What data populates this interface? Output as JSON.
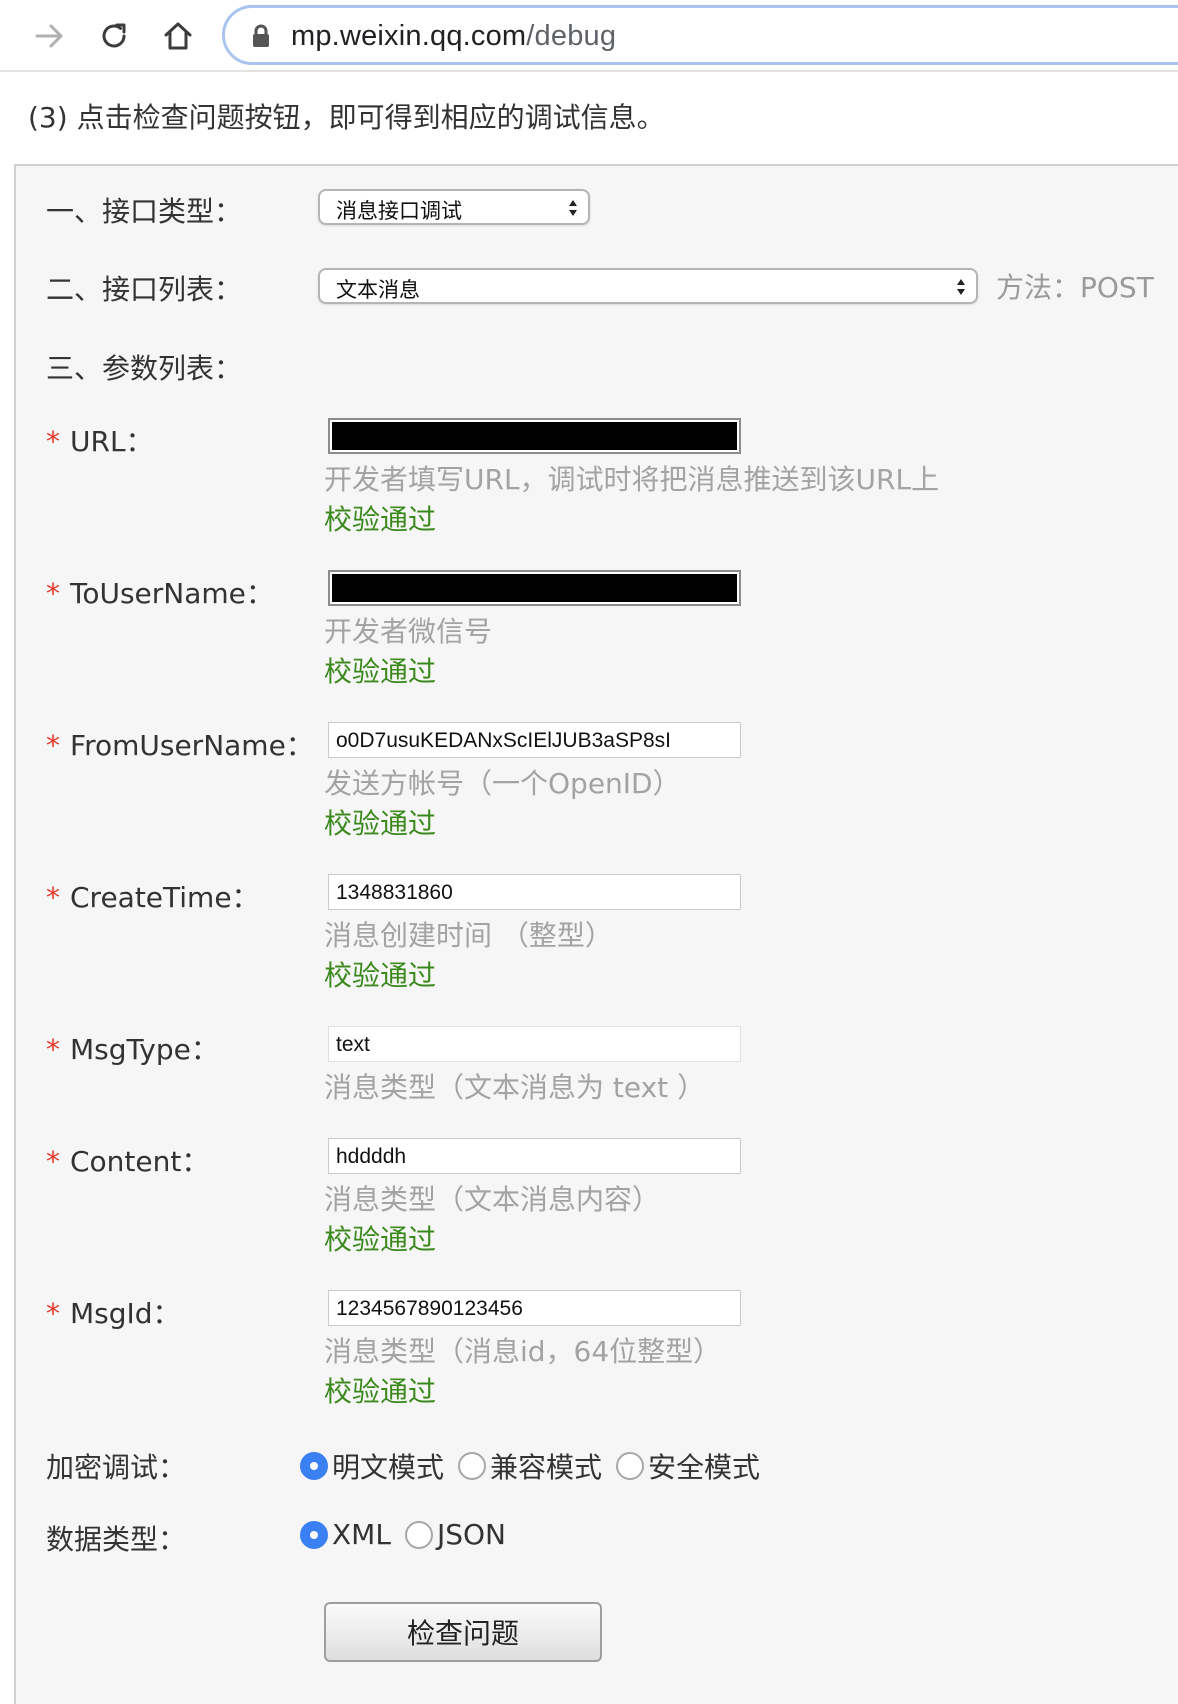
{
  "browser": {
    "url_host": "mp.weixin.qq.com",
    "url_path": "/debug"
  },
  "intro": "(3) 点击检查问题按钮，即可得到相应的调试信息。",
  "section1": {
    "label": "一、接口类型：",
    "select_value": "消息接口调试"
  },
  "section2": {
    "label": "二、接口列表：",
    "select_value": "文本消息",
    "method": "方法：POST"
  },
  "section3": {
    "label": "三、参数列表："
  },
  "required_mark": "*",
  "fields": [
    {
      "label": "URL：",
      "value": "",
      "hint": "开发者填写URL，调试时将把消息推送到该URL上",
      "status": "校验通过"
    },
    {
      "label": "ToUserName：",
      "value": "",
      "hint": "开发者微信号",
      "status": "校验通过"
    },
    {
      "label": "FromUserName：",
      "value": "o0D7usuKEDANxScIElJUB3aSP8sI",
      "hint": "发送方帐号（一个OpenID）",
      "status": "校验通过"
    },
    {
      "label": "CreateTime：",
      "value": "1348831860",
      "hint": "消息创建时间 （整型）",
      "status": "校验通过"
    },
    {
      "label": "MsgType：",
      "value": "text",
      "hint": "消息类型（文本消息为 text ）",
      "status": ""
    },
    {
      "label": "Content：",
      "value": "hddddh",
      "hint": "消息类型（文本消息内容）",
      "status": "校验通过"
    },
    {
      "label": "MsgId：",
      "value": "1234567890123456",
      "hint": "消息类型（消息id，64位整型）",
      "status": "校验通过"
    }
  ],
  "encryption": {
    "label": "加密调试：",
    "options": [
      "明文模式",
      "兼容模式",
      "安全模式"
    ],
    "selected": "明文模式"
  },
  "datatype": {
    "label": "数据类型：",
    "options": [
      "XML",
      "JSON"
    ],
    "selected": "XML"
  },
  "submit_label": "检查问题"
}
